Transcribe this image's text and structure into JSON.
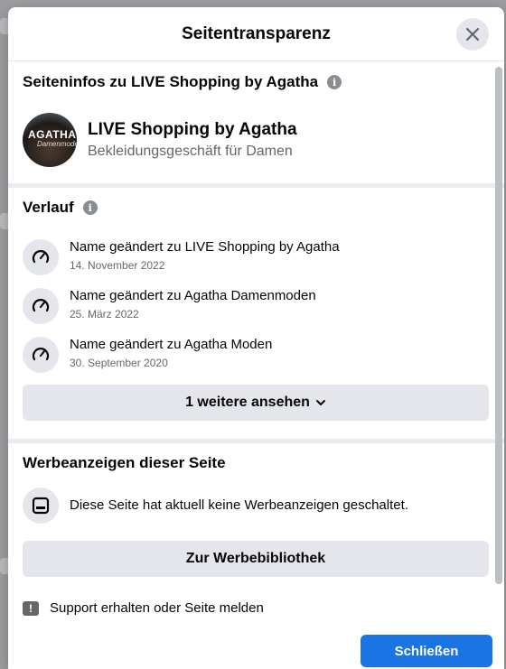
{
  "dialog": {
    "title": "Seitentransparenz",
    "close_icon": "close-icon"
  },
  "page_info": {
    "title": "Seiteninfos zu LIVE Shopping by Agatha",
    "avatar_text": "AGATHA",
    "avatar_script": "Damenmode",
    "page_name": "LIVE Shopping by Agatha",
    "category": "Bekleidungsgeschäft für Damen"
  },
  "history": {
    "title": "Verlauf",
    "items": [
      {
        "prefix": "Name geändert zu ",
        "name": "LIVE Shopping by Agatha",
        "date": "14. November 2022",
        "icon": "speedometer-icon"
      },
      {
        "prefix": "Name geändert zu ",
        "name": "Agatha Damenmoden",
        "date": "25. März 2022",
        "icon": "speedometer-icon"
      },
      {
        "prefix": "Name geändert zu ",
        "name": "Agatha Moden",
        "date": "30. September 2020",
        "icon": "speedometer-icon"
      }
    ],
    "more_label": "1 weitere ansehen"
  },
  "ads": {
    "title": "Werbeanzeigen dieser Seite",
    "message": "Diese Seite hat aktuell keine Werbeanzeigen geschaltet.",
    "library_label": "Zur Werbebibliothek"
  },
  "footer": {
    "support_label": "Support erhalten oder Seite melden",
    "close_label": "Schließen"
  },
  "colors": {
    "primary": "#1b74e4",
    "secondary_button": "#e4e6eb",
    "muted_text": "#65676b"
  }
}
